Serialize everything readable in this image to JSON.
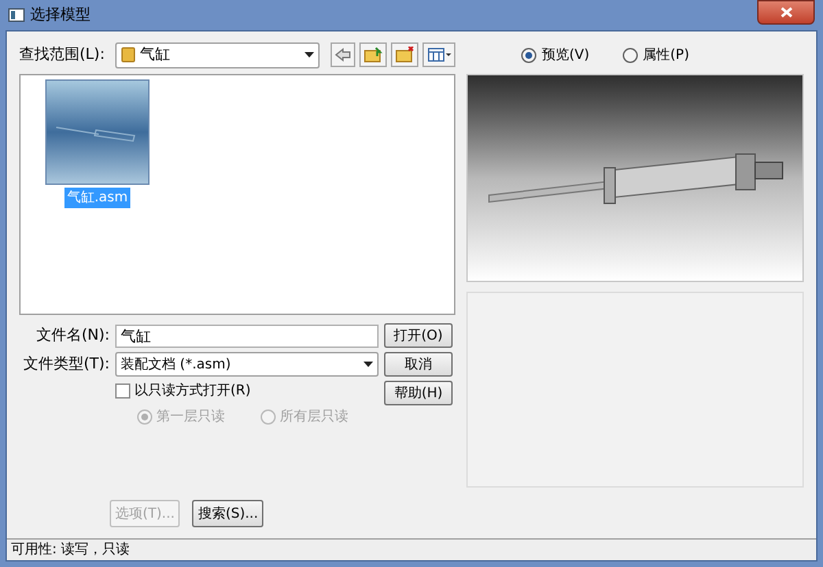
{
  "window": {
    "title": "选择模型"
  },
  "look_in": {
    "label": "查找范围(L):",
    "value": "气缸"
  },
  "files": [
    {
      "name": "气缸.asm",
      "selected": true
    }
  ],
  "view_options": [
    {
      "label": "预览(V)",
      "selected": true
    },
    {
      "label": "属性(P)",
      "selected": false
    }
  ],
  "file_name": {
    "label": "文件名(N):",
    "value": "气缸"
  },
  "file_type": {
    "label": "文件类型(T):",
    "value": "装配文档 (*.asm)"
  },
  "read_only": {
    "label": "以只读方式打开(R)",
    "checked": false
  },
  "read_levels": [
    {
      "label": "第一层只读",
      "selected": true,
      "disabled": true
    },
    {
      "label": "所有层只读",
      "selected": false,
      "disabled": true
    }
  ],
  "side_buttons": [
    {
      "label": "打开(O)"
    },
    {
      "label": "取消"
    },
    {
      "label": "帮助(H)"
    }
  ],
  "bottom_buttons": [
    {
      "label": "选项(T)...",
      "disabled": true
    },
    {
      "label": "搜索(S)...",
      "disabled": false
    }
  ],
  "status_bar": "可用性: 读写，只读"
}
